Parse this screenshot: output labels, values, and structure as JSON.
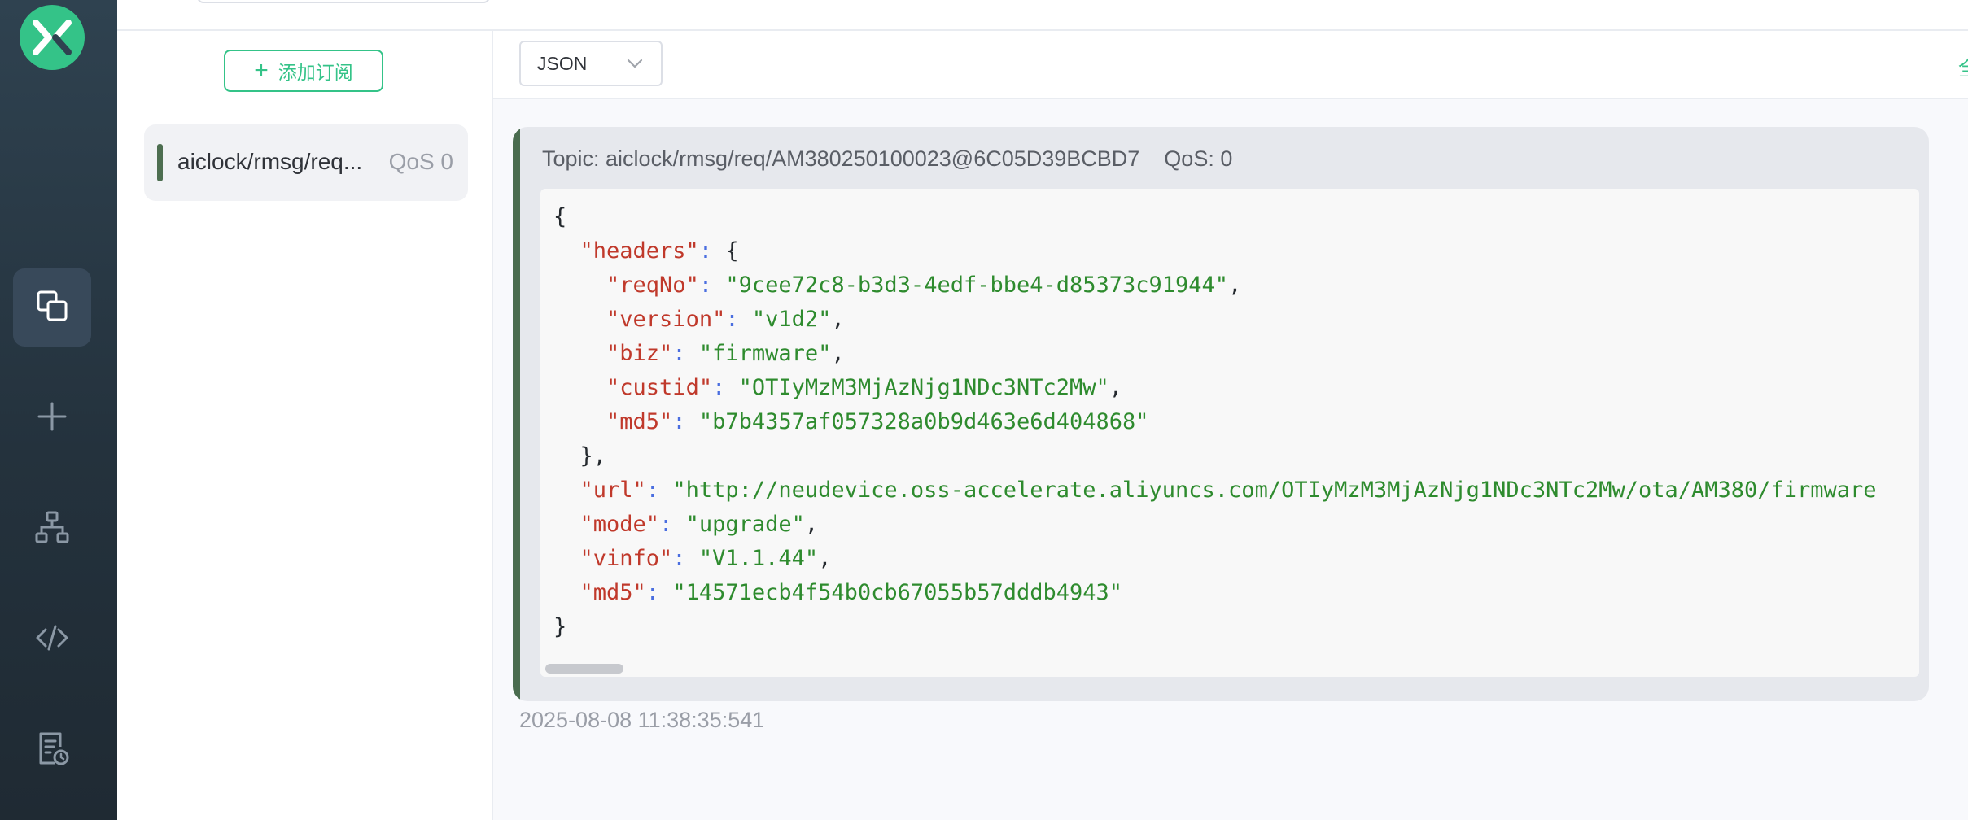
{
  "nav": {
    "items": [
      {
        "name": "connections-icon",
        "active": true
      },
      {
        "name": "new-connection-icon",
        "active": false
      },
      {
        "name": "topology-icon",
        "active": false
      },
      {
        "name": "script-icon",
        "active": false
      },
      {
        "name": "log-icon",
        "active": false
      }
    ]
  },
  "subscriptions": {
    "add_button_label": "添加订阅",
    "items": [
      {
        "topic": "aiclock/rmsg/req...",
        "qos": "QoS 0",
        "color": "#4d6e50"
      }
    ]
  },
  "toolbar": {
    "format": "JSON",
    "edge_text": "全"
  },
  "message": {
    "meta": "Topic: aiclock/rmsg/req/AM380250100023@6C05D39BCBD7    QoS: 0",
    "payload_lines": [
      [
        [
          "p",
          "{"
        ]
      ],
      [
        [
          "p",
          "  "
        ],
        [
          "k",
          "\"headers\""
        ],
        [
          "c",
          ":"
        ],
        [
          "p",
          " {"
        ]
      ],
      [
        [
          "p",
          "    "
        ],
        [
          "k",
          "\"reqNo\""
        ],
        [
          "c",
          ":"
        ],
        [
          "p",
          " "
        ],
        [
          "s",
          "\"9cee72c8-b3d3-4edf-bbe4-d85373c91944\""
        ],
        [
          "p",
          ","
        ]
      ],
      [
        [
          "p",
          "    "
        ],
        [
          "k",
          "\"version\""
        ],
        [
          "c",
          ":"
        ],
        [
          "p",
          " "
        ],
        [
          "s",
          "\"v1d2\""
        ],
        [
          "p",
          ","
        ]
      ],
      [
        [
          "p",
          "    "
        ],
        [
          "k",
          "\"biz\""
        ],
        [
          "c",
          ":"
        ],
        [
          "p",
          " "
        ],
        [
          "s",
          "\"firmware\""
        ],
        [
          "p",
          ","
        ]
      ],
      [
        [
          "p",
          "    "
        ],
        [
          "k",
          "\"custid\""
        ],
        [
          "c",
          ":"
        ],
        [
          "p",
          " "
        ],
        [
          "s",
          "\"OTIyMzM3MjAzNjg1NDc3NTc2Mw\""
        ],
        [
          "p",
          ","
        ]
      ],
      [
        [
          "p",
          "    "
        ],
        [
          "k",
          "\"md5\""
        ],
        [
          "c",
          ":"
        ],
        [
          "p",
          " "
        ],
        [
          "s",
          "\"b7b4357af057328a0b9d463e6d404868\""
        ]
      ],
      [
        [
          "p",
          "  },"
        ]
      ],
      [
        [
          "p",
          "  "
        ],
        [
          "k",
          "\"url\""
        ],
        [
          "c",
          ":"
        ],
        [
          "p",
          " "
        ],
        [
          "s",
          "\"http://neudevice.oss-accelerate.aliyuncs.com/OTIyMzM3MjAzNjg1NDc3NTc2Mw/ota/AM380/firmware"
        ]
      ],
      [
        [
          "p",
          "  "
        ],
        [
          "k",
          "\"mode\""
        ],
        [
          "c",
          ":"
        ],
        [
          "p",
          " "
        ],
        [
          "s",
          "\"upgrade\""
        ],
        [
          "p",
          ","
        ]
      ],
      [
        [
          "p",
          "  "
        ],
        [
          "k",
          "\"vinfo\""
        ],
        [
          "c",
          ":"
        ],
        [
          "p",
          " "
        ],
        [
          "s",
          "\"V1.1.44\""
        ],
        [
          "p",
          ","
        ]
      ],
      [
        [
          "p",
          "  "
        ],
        [
          "k",
          "\"md5\""
        ],
        [
          "c",
          ":"
        ],
        [
          "p",
          " "
        ],
        [
          "s",
          "\"14571ecb4f54b0cb67055b57dddb4943\""
        ]
      ],
      [
        [
          "p",
          "}"
        ]
      ]
    ],
    "timestamp": "2025-08-08 11:38:35:541"
  },
  "colors": {
    "accent": "#34c388",
    "nav_bg": "#2a3a46",
    "json_key": "#c0392b",
    "json_string": "#2e8b2e",
    "json_colon": "#4a6ee0"
  }
}
